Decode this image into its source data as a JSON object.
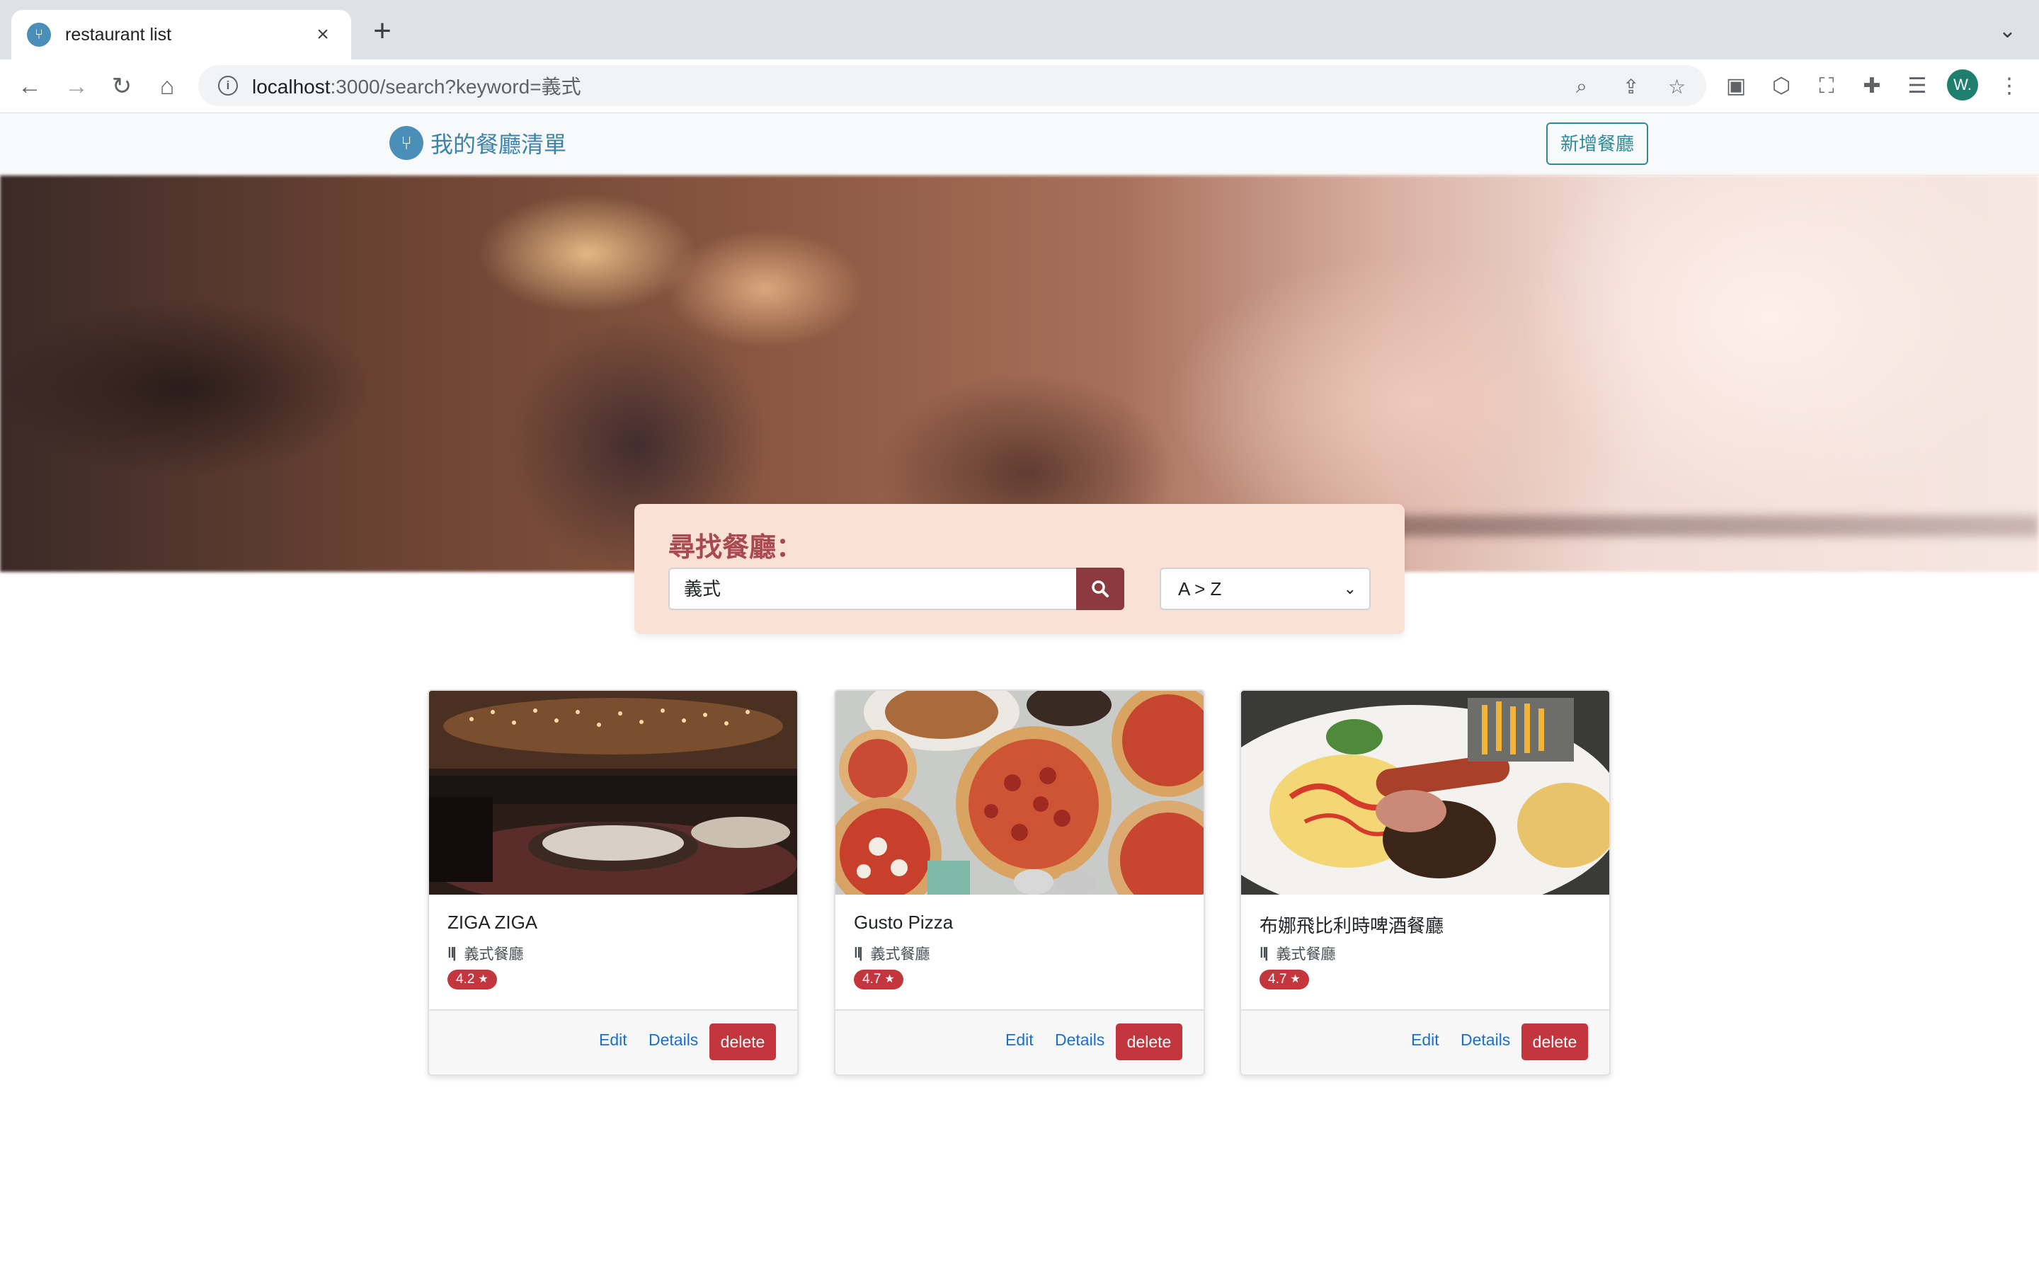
{
  "browser": {
    "tab_title": "restaurant list",
    "new_tab": "+",
    "url_host": "localhost",
    "url_rest": ":3000/search?keyword=義式",
    "profile_initial": "W."
  },
  "navbar": {
    "brand": "我的餐廳清單",
    "add_button": "新增餐廳"
  },
  "search": {
    "title": "尋找餐廳：",
    "keyword": "義式",
    "sort_selected": "A > Z"
  },
  "restaurants": [
    {
      "name": "ZIGA ZIGA",
      "category": "義式餐廳",
      "rating": "4.2",
      "edit": "Edit",
      "details": "Details",
      "delete": "delete"
    },
    {
      "name": "Gusto Pizza",
      "category": "義式餐廳",
      "rating": "4.7",
      "edit": "Edit",
      "details": "Details",
      "delete": "delete"
    },
    {
      "name": "布娜飛比利時啤酒餐廳",
      "category": "義式餐廳",
      "rating": "4.7",
      "edit": "Edit",
      "details": "Details",
      "delete": "delete"
    }
  ],
  "colors": {
    "brand": "#3a84ad",
    "accent": "#a84a4f",
    "danger": "#c4363d",
    "search_bg": "#f9e1d5"
  },
  "icons": {
    "brand": "utensils-circle-icon",
    "category": "utensils-icon",
    "rating": "star-icon",
    "search": "search-icon"
  }
}
